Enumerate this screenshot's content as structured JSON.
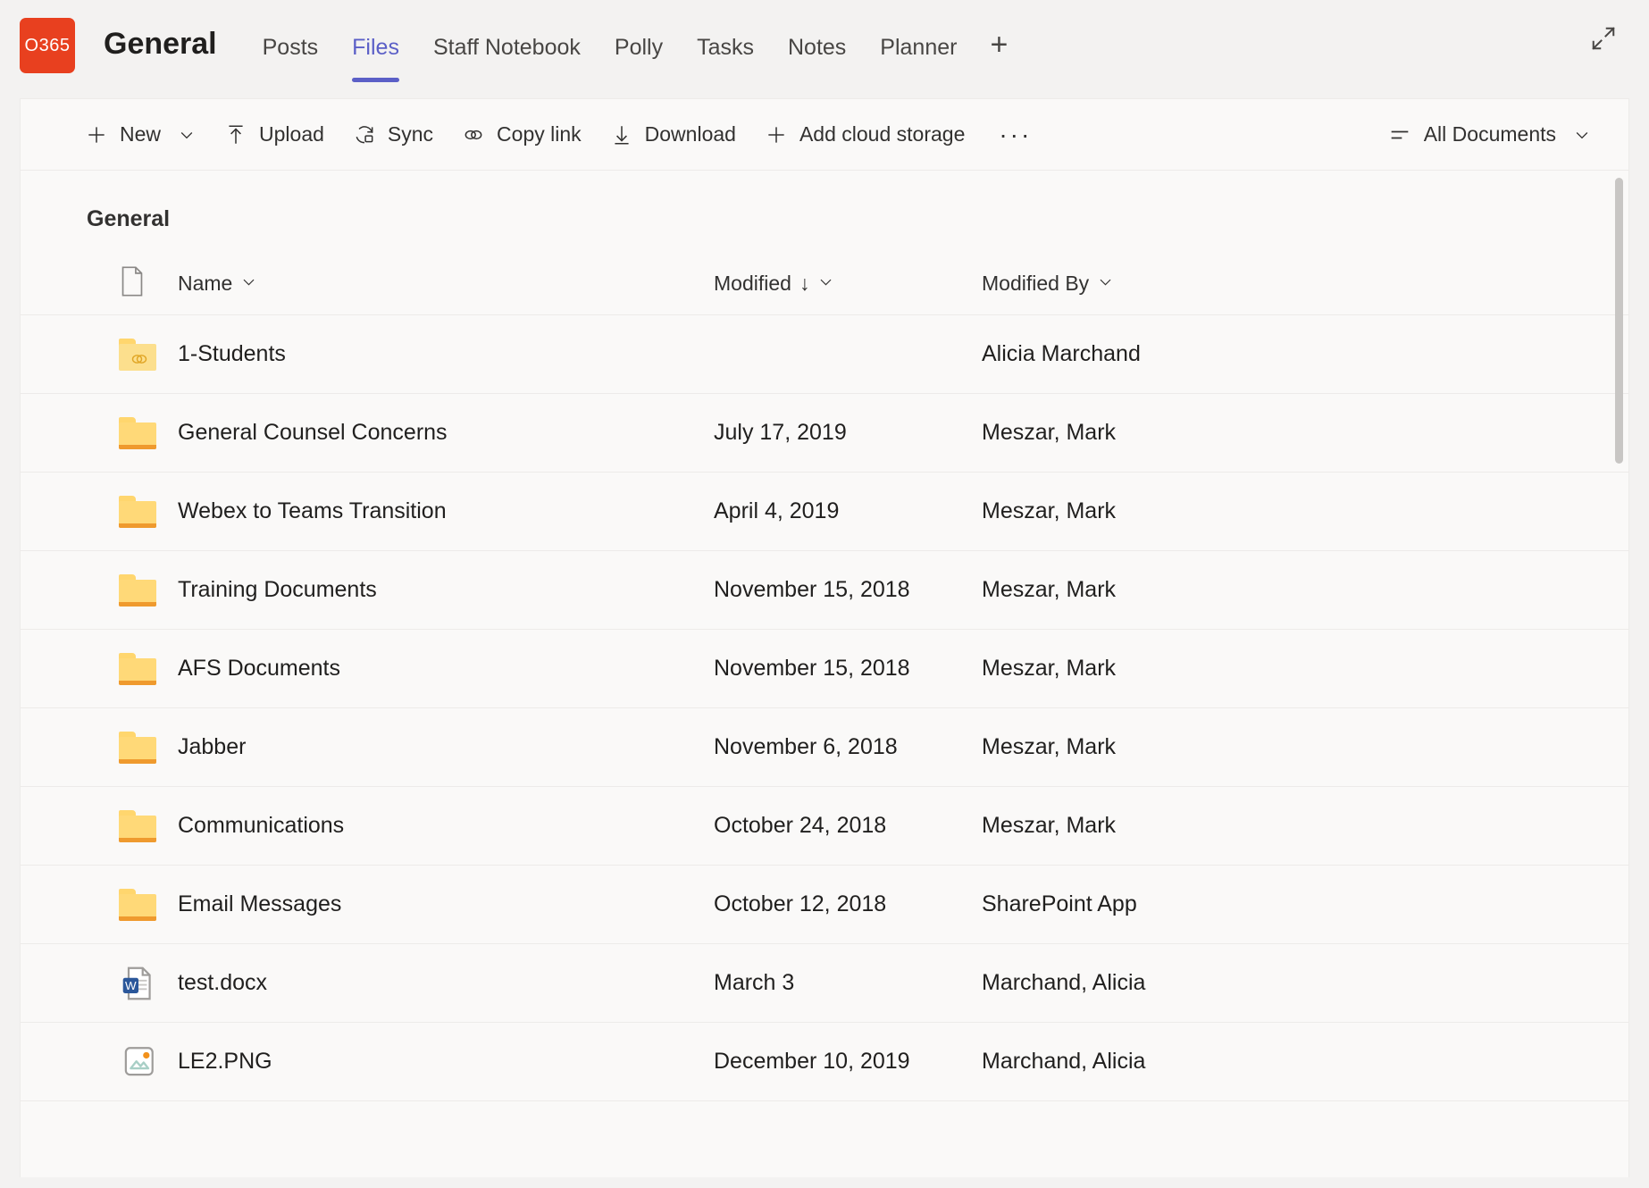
{
  "header": {
    "logo_text": "O365",
    "logo_color": "#e8401f",
    "channel_title": "General",
    "expand_icon": "expand-icon",
    "tabs": [
      {
        "label": "Posts",
        "active": false
      },
      {
        "label": "Files",
        "active": true
      },
      {
        "label": "Staff Notebook",
        "active": false
      },
      {
        "label": "Polly",
        "active": false
      },
      {
        "label": "Tasks",
        "active": false
      },
      {
        "label": "Notes",
        "active": false
      },
      {
        "label": "Planner",
        "active": false
      }
    ],
    "add_tab_label": "+",
    "accent_color": "#5b5fc7"
  },
  "command_bar": {
    "new_label": "New",
    "upload_label": "Upload",
    "sync_label": "Sync",
    "copy_link_label": "Copy link",
    "download_label": "Download",
    "add_cloud_storage_label": "Add cloud storage",
    "overflow_label": "···",
    "view_label": "All Documents"
  },
  "breadcrumb": {
    "label": "General"
  },
  "table": {
    "columns": {
      "icon": "",
      "name": "Name",
      "modified": "Modified",
      "modified_by": "Modified By"
    },
    "sort": {
      "column": "Modified",
      "direction": "descending",
      "arrow": "↓"
    },
    "rows": [
      {
        "icon": "shared-folder-icon",
        "name": "1-Students",
        "modified": "",
        "modified_by": "Alicia Marchand"
      },
      {
        "icon": "folder-icon",
        "name": "General Counsel Concerns",
        "modified": "July 17, 2019",
        "modified_by": "Meszar, Mark"
      },
      {
        "icon": "folder-icon",
        "name": "Webex to Teams Transition",
        "modified": "April 4, 2019",
        "modified_by": "Meszar, Mark"
      },
      {
        "icon": "folder-icon",
        "name": "Training Documents",
        "modified": "November 15, 2018",
        "modified_by": "Meszar, Mark"
      },
      {
        "icon": "folder-icon",
        "name": "AFS Documents",
        "modified": "November 15, 2018",
        "modified_by": "Meszar, Mark"
      },
      {
        "icon": "folder-icon",
        "name": "Jabber",
        "modified": "November 6, 2018",
        "modified_by": "Meszar, Mark"
      },
      {
        "icon": "folder-icon",
        "name": "Communications",
        "modified": "October 24, 2018",
        "modified_by": "Meszar, Mark"
      },
      {
        "icon": "folder-icon",
        "name": "Email Messages",
        "modified": "October 12, 2018",
        "modified_by": "SharePoint App"
      },
      {
        "icon": "word-document-icon",
        "name": "test.docx",
        "modified": "March 3",
        "modified_by": "Marchand, Alicia"
      },
      {
        "icon": "image-file-icon",
        "name": "LE2.PNG",
        "modified": "December 10, 2019",
        "modified_by": "Marchand, Alicia"
      }
    ]
  }
}
